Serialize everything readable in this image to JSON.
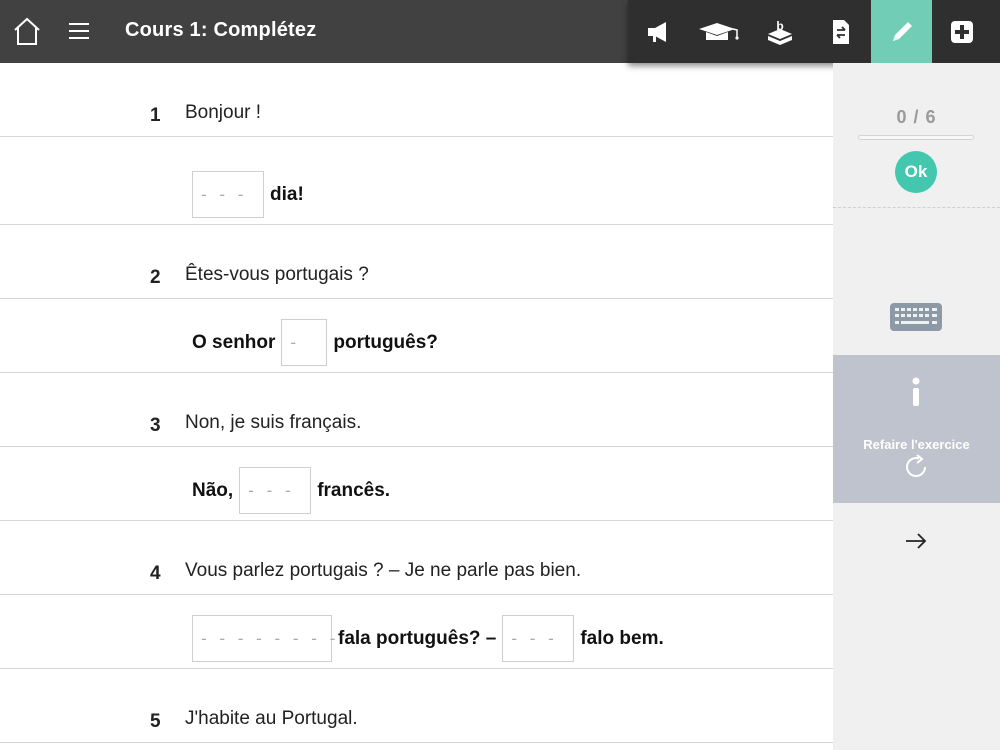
{
  "header": {
    "title": "Cours 1: Complétez",
    "home_icon": "home-icon",
    "menu_icon": "hamburger-menu-icon"
  },
  "toolbar": {
    "tools": [
      {
        "icon": "megaphone-icon",
        "active": false
      },
      {
        "icon": "graduation-cap-icon",
        "active": false
      },
      {
        "icon": "vocabulary-box-icon",
        "active": false
      },
      {
        "icon": "document-swap-icon",
        "active": false
      },
      {
        "icon": "pencil-icon",
        "active": true
      },
      {
        "icon": "plus-square-icon",
        "active": false
      }
    ],
    "active_color": "#72cdb6"
  },
  "exercise": {
    "items": [
      {
        "number": "1",
        "prompt": "Bonjour !",
        "answer": {
          "before": "",
          "blank1": "- - -",
          "middle": "dia!",
          "blank2": "",
          "after": ""
        }
      },
      {
        "number": "2",
        "prompt": "Êtes-vous portugais ?",
        "answer": {
          "before": "O senhor",
          "blank1": "-",
          "middle": "português?",
          "blank2": "",
          "after": ""
        }
      },
      {
        "number": "3",
        "prompt": "Non, je suis français.",
        "answer": {
          "before": "Não,",
          "blank1": "- - -",
          "middle": "francês.",
          "blank2": "",
          "after": ""
        }
      },
      {
        "number": "4",
        "prompt": "Vous parlez portugais ? – Je ne parle pas bien.",
        "answer": {
          "before": "",
          "blank1": "- - - - - - - -",
          "middle": "fala português? –",
          "blank2": "- - -",
          "after": "falo bem."
        }
      },
      {
        "number": "5",
        "prompt": "J'habite au Portugal."
      }
    ]
  },
  "side": {
    "score": "0 / 6",
    "progress": 0,
    "ok_label": "Ok",
    "ok_color": "#43c7ae",
    "keyboard_icon": "keyboard-icon",
    "info_icon": "info-icon",
    "redo_label": "Refaire l'exercice",
    "redo_icon": "refresh-icon",
    "next_icon": "arrow-right-icon",
    "redo_panel_color": "#bfc3cd"
  }
}
